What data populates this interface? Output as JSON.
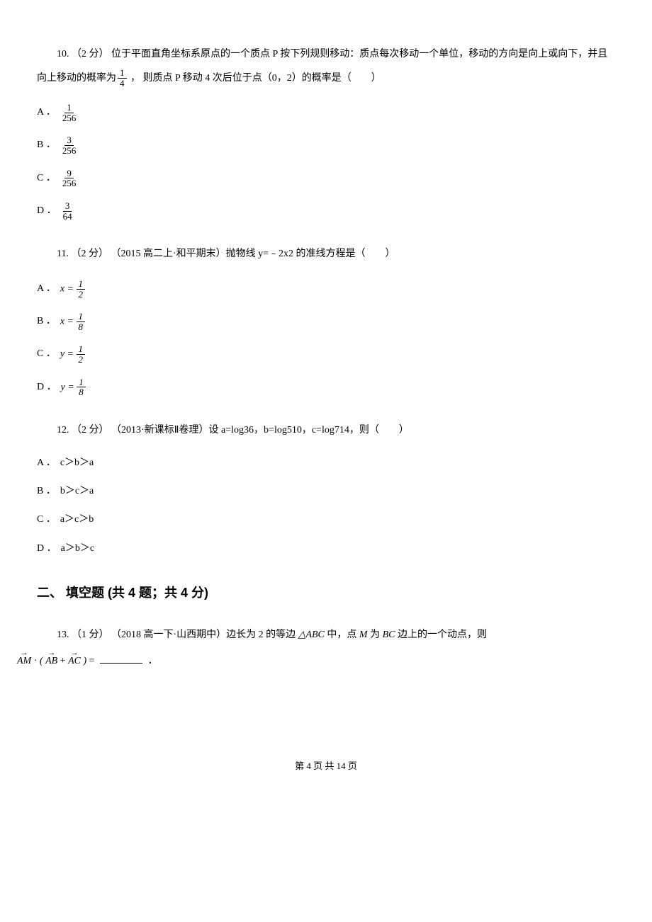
{
  "question10": {
    "prefix": "10. （2 分） 位于平面直角坐标系原点的一个质点 P 按下列规则移动：质点每次移动一个单位，移动的方向是向上或向下，并且向上移动的概率为",
    "frac_num": "1",
    "frac_den": "4",
    "suffix": " ， 则质点 P 移动 4 次后位于点（0，2）的概率是（　　）",
    "options": {
      "A": {
        "label": "A ．",
        "num": "1",
        "den": "256"
      },
      "B": {
        "label": "B ．",
        "num": "3",
        "den": "256"
      },
      "C": {
        "label": "C ．",
        "num": "9",
        "den": "256"
      },
      "D": {
        "label": "D ．",
        "num": "3",
        "den": "64"
      }
    }
  },
  "question11": {
    "text": "11. （2 分） （2015 高二上·和平期末）抛物线 y=﹣2x2 的准线方程是（　　）",
    "options": {
      "A": {
        "label": "A ．",
        "lhs": "x =",
        "num": "1",
        "den": "2"
      },
      "B": {
        "label": "B ．",
        "lhs": "x =",
        "num": "1",
        "den": "8"
      },
      "C": {
        "label": "C ．",
        "lhs": "y =",
        "num": "1",
        "den": "2"
      },
      "D": {
        "label": "D ．",
        "lhs": "y =",
        "num": "1",
        "den": "8"
      }
    }
  },
  "question12": {
    "text": "12. （2 分） （2013·新课标Ⅱ卷理）设 a=log36，b=log510，c=log714，则（　　）",
    "options": {
      "A": {
        "label": "A ．",
        "content": "c＞b＞a"
      },
      "B": {
        "label": "B ．",
        "content": "b＞c＞a"
      },
      "C": {
        "label": "C ．",
        "content": "a＞c＞b"
      },
      "D": {
        "label": "D ．",
        "content": "a＞b＞c"
      }
    }
  },
  "section2": {
    "header": "二、 填空题 (共 4 题；共 4 分)"
  },
  "question13": {
    "prefix": "13. （1 分） （2018 高一下·山西期中）边长为 2 的等边 ",
    "triangle": "△ABC",
    "mid1": " 中，点 ",
    "pointM": "M",
    "mid2": " 为 ",
    "sideBC": "BC",
    "mid3": " 边上的一个动点，则 ",
    "vecAM": "AM",
    "dot": " · ",
    "lparen": "(",
    "vecAB": "AB",
    "plus": " + ",
    "vecAC": "AC",
    "rparen": ")",
    "eq": " = ",
    "period": "．"
  },
  "footer": {
    "text": "第 4 页 共 14 页"
  }
}
